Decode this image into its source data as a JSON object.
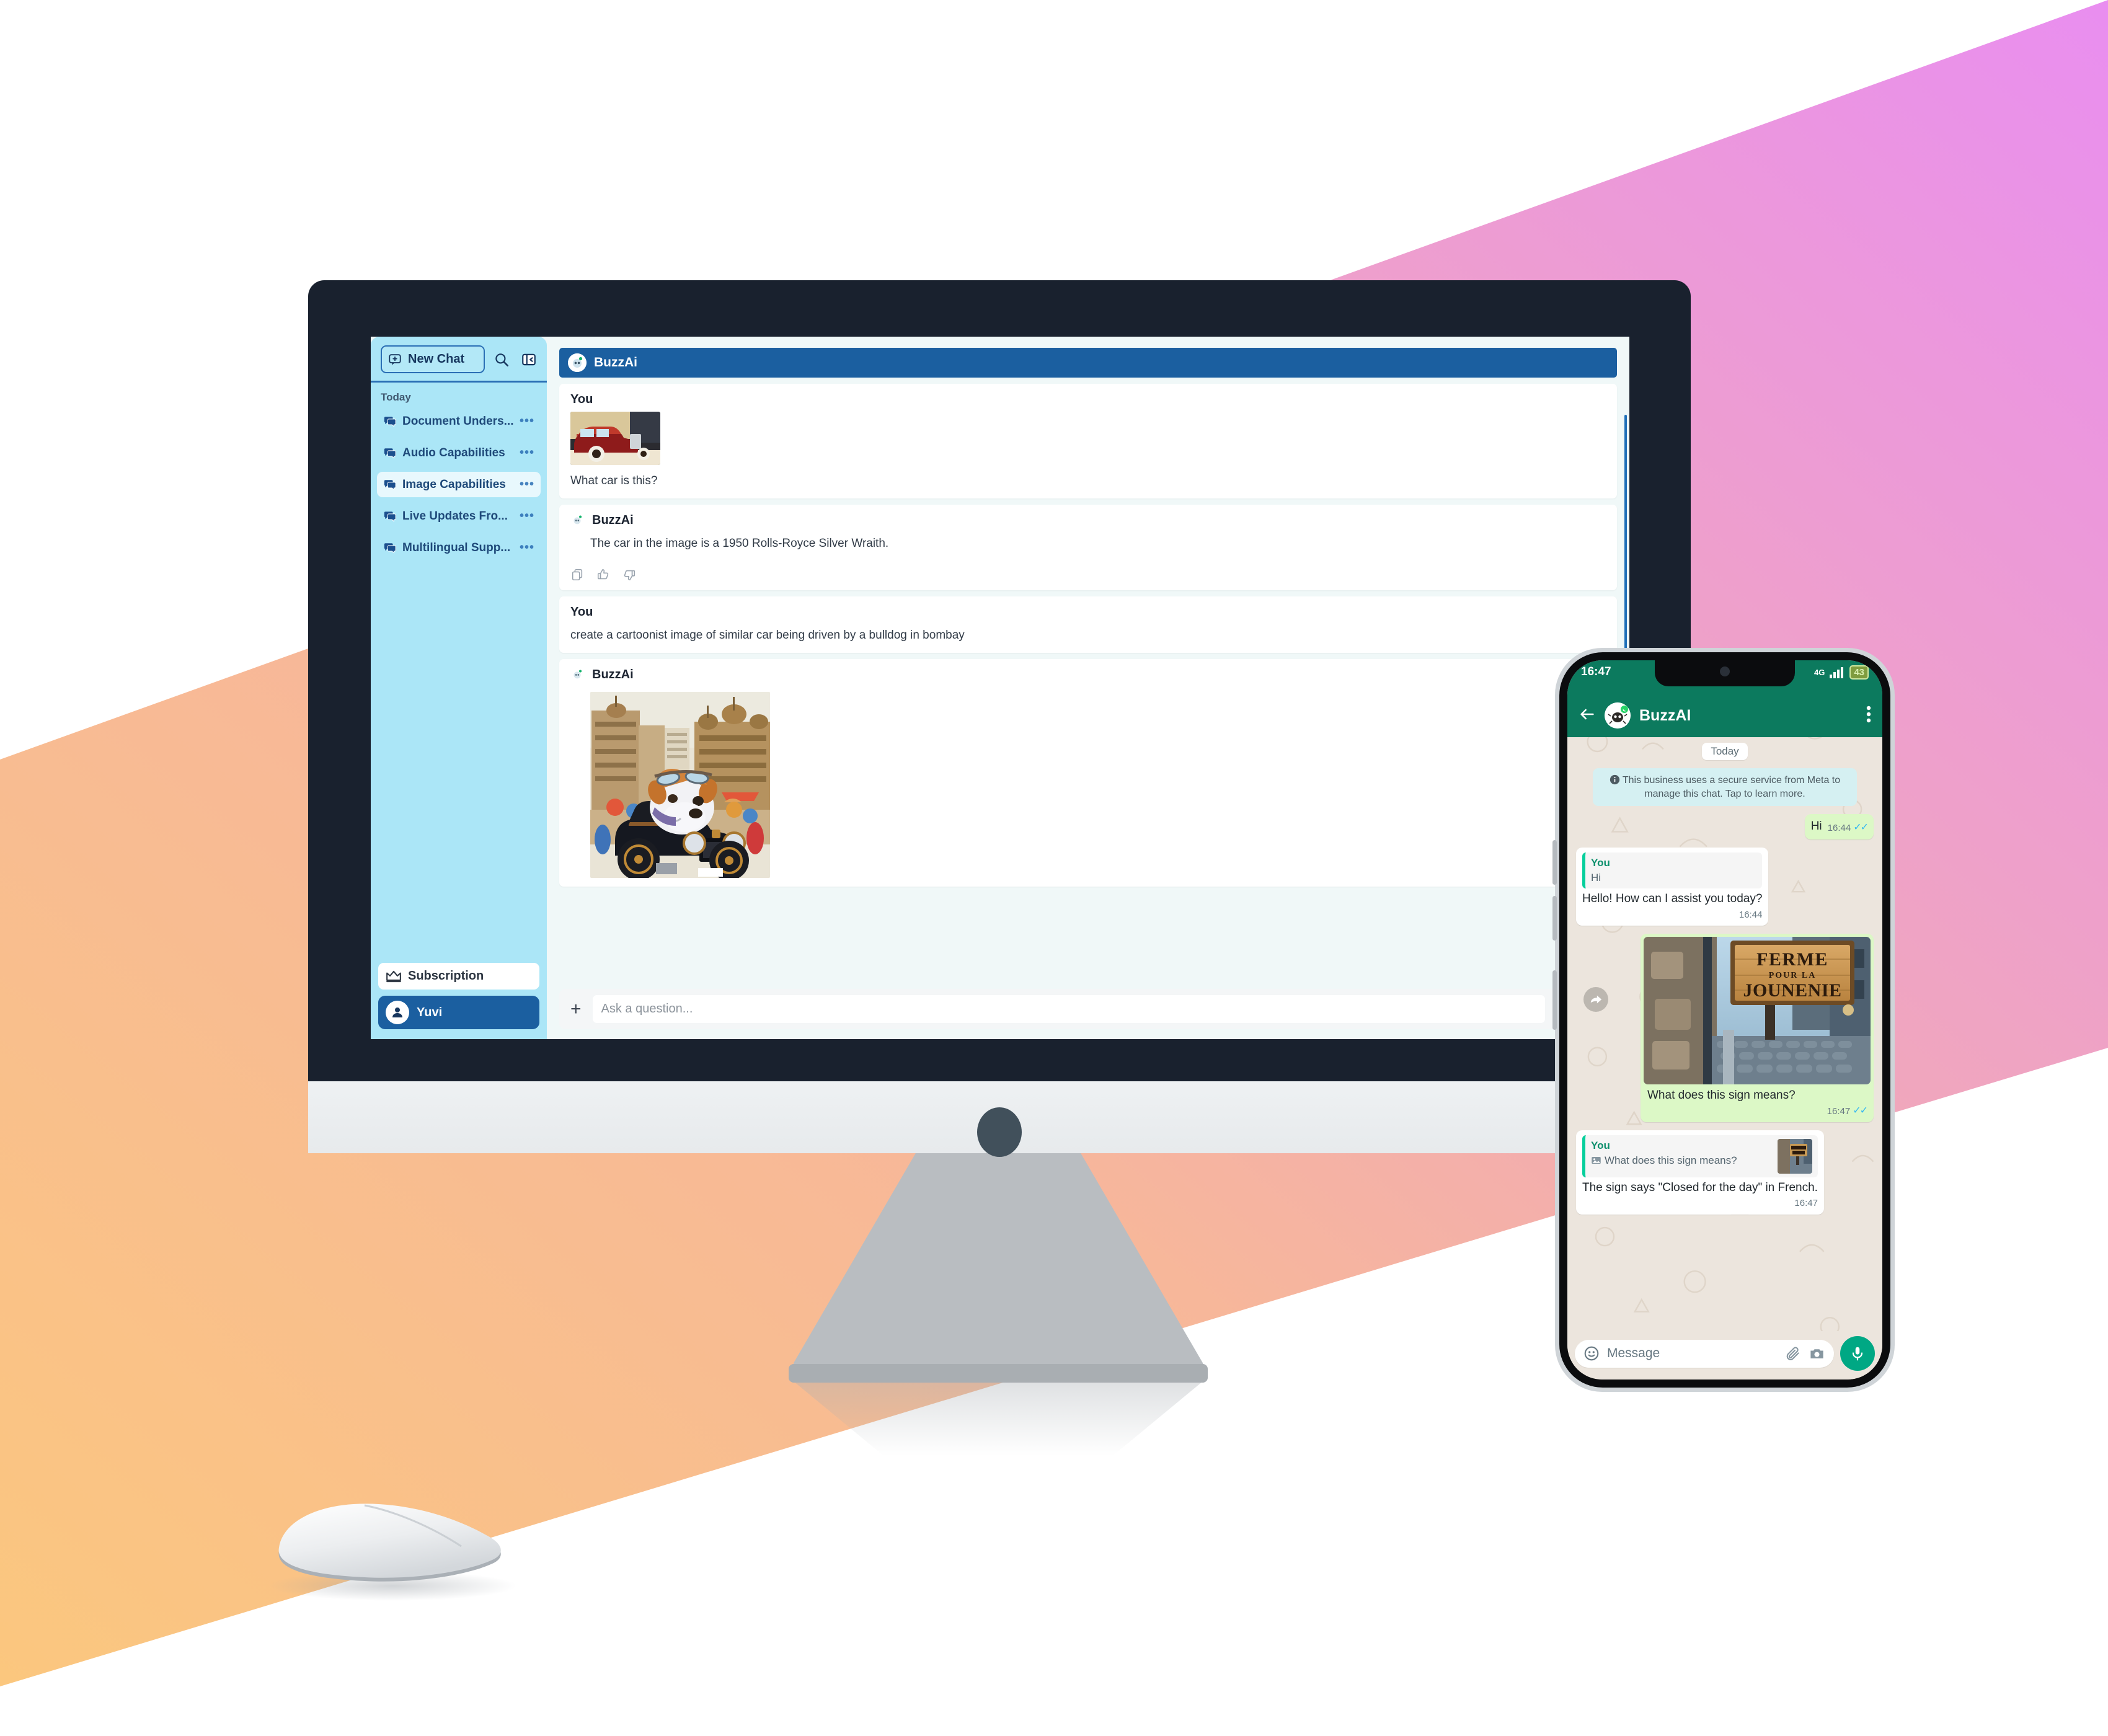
{
  "background": {
    "band_color_top_right": "#e98ef0",
    "band_color_mid": "#f5b0ae",
    "band_color_bottom_left": "#fbc77e",
    "page_color": "#ffffff"
  },
  "desktop_app": {
    "sidebar": {
      "new_chat_label": "New Chat",
      "search_icon": "search-icon",
      "collapse_icon": "panel-collapse-icon",
      "group_label": "Today",
      "chats": [
        {
          "label": "Document Unders...",
          "icon": "chat-bubbles-icon",
          "menu": "•••",
          "active": false
        },
        {
          "label": "Audio Capabilities",
          "icon": "chat-bubbles-icon",
          "menu": "•••",
          "active": false
        },
        {
          "label": "Image Capabilities",
          "icon": "chat-bubbles-icon",
          "menu": "•••",
          "active": true
        },
        {
          "label": "Live Updates Fro...",
          "icon": "chat-bubbles-icon",
          "menu": "•••",
          "active": false
        },
        {
          "label": "Multilingual Supp...",
          "icon": "chat-bubbles-icon",
          "menu": "•••",
          "active": false
        }
      ],
      "subscription_label": "Subscription",
      "subscription_icon": "crown-icon",
      "user_name": "Yuvi",
      "user_icon": "user-avatar-icon"
    },
    "chat_header": {
      "title": "BuzzAi",
      "avatar_icon": "buzzai-avatar-icon"
    },
    "messages": [
      {
        "author": "You",
        "type": "image_with_text",
        "image_alt": "vintage maroon Rolls-Royce car photo",
        "text": "What car is this?"
      },
      {
        "author": "BuzzAi",
        "type": "text",
        "text": "The car in the image is a 1950 Rolls-Royce Silver Wraith.",
        "actions": [
          "copy-icon",
          "thumbs-up-icon",
          "thumbs-down-icon"
        ]
      },
      {
        "author": "You",
        "type": "text",
        "text": "create a cartoonist image of similar car being driven by a bulldog in bombay"
      },
      {
        "author": "BuzzAi",
        "type": "image",
        "image_alt": "cartoon bulldog with goggles driving a vintage car in a Bombay street scene"
      }
    ],
    "composer": {
      "attach_icon": "plus-icon",
      "placeholder": "Ask a question...",
      "value": "",
      "send_icon": "send-paper-plane-icon",
      "mic_icon": "microphone-icon"
    },
    "download_icon": "download-arrow-icon"
  },
  "phone_app": {
    "status_bar": {
      "time": "16:47",
      "network": "4G",
      "battery": "43",
      "signal_icon": "signal-bars-icon"
    },
    "header": {
      "back_icon": "back-arrow-icon",
      "title": "BuzzAI",
      "avatar_icon": "buzzai-avatar-icon",
      "menu_icon": "overflow-menu-icon"
    },
    "day_divider": "Today",
    "system_notice": "This business uses a secure service from Meta to manage this chat. Tap to learn more.",
    "system_notice_icon": "info-icon",
    "messages": [
      {
        "side": "out",
        "text": "Hi",
        "time": "16:44",
        "status": "read"
      },
      {
        "side": "in",
        "quote": {
          "name": "You",
          "text": "Hi"
        },
        "text": "Hello! How can I assist you today?",
        "time": "16:44"
      },
      {
        "side": "out",
        "type": "image",
        "image_alt": "wooden street sign reading FERME POUR LA JOUNENIE in an alley",
        "sign_line1": "FERME",
        "sign_line2": "POUR LA",
        "sign_line3": "JOUNENIE",
        "text": "What does this sign means?",
        "time": "16:47",
        "status": "read",
        "forward_icon": "forward-arrow-icon"
      },
      {
        "side": "in",
        "quote": {
          "name": "You",
          "text": "What does this sign means?",
          "icon": "photo-icon",
          "thumb_alt": "street sign thumbnail"
        },
        "text": "The sign says \"Closed for the day\" in French.",
        "time": "16:47"
      }
    ],
    "composer": {
      "emoji_icon": "emoji-smiley-icon",
      "placeholder": "Message",
      "attach_icon": "paperclip-icon",
      "camera_icon": "camera-icon",
      "mic_icon": "microphone-icon"
    }
  },
  "hardware": {
    "monitor_name": "desktop-monitor",
    "mouse_name": "computer-mouse",
    "phone_name": "smartphone"
  }
}
